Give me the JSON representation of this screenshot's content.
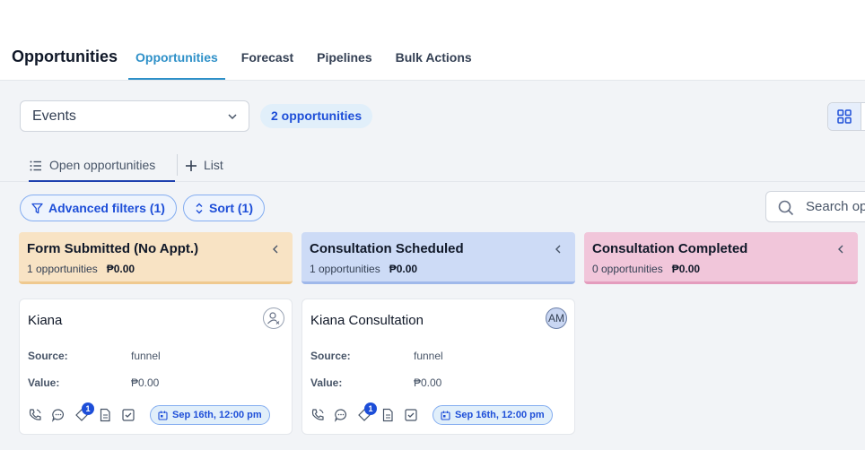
{
  "header": {
    "title": "Opportunities",
    "tabs": [
      {
        "label": "Opportunities",
        "active": true
      },
      {
        "label": "Forecast",
        "active": false
      },
      {
        "label": "Pipelines",
        "active": false
      },
      {
        "label": "Bulk Actions",
        "active": false
      }
    ]
  },
  "toolbar": {
    "pipeline_value": "Events",
    "count_badge": "2 opportunities"
  },
  "subtabs": {
    "open": "Open opportunities",
    "list": "List"
  },
  "filters": {
    "advanced": "Advanced filters (1)",
    "sort": "Sort (1)",
    "search_placeholder": "Search opportunities"
  },
  "columns": [
    {
      "title": "Form Submitted (No Appt.)",
      "count": "1 opportunities",
      "value": "₱0.00",
      "color": "#f8e3c4"
    },
    {
      "title": "Consultation Scheduled",
      "count": "1 opportunities",
      "value": "₱0.00",
      "color": "#cddbf6"
    },
    {
      "title": "Consultation Completed",
      "count": "0 opportunities",
      "value": "₱0.00",
      "color": "#f1c6da"
    }
  ],
  "cards": [
    {
      "name": "Kiana",
      "source_label": "Source:",
      "source": "funnel",
      "value_label": "Value:",
      "value": "₱0.00",
      "date": "Sep 16th, 12:00 pm",
      "badge": "1",
      "avatar": ""
    },
    {
      "name": "Kiana Consultation",
      "source_label": "Source:",
      "source": "funnel",
      "value_label": "Value:",
      "value": "₱0.00",
      "date": "Sep 16th, 12:00 pm",
      "badge": "1",
      "avatar": "AM"
    }
  ],
  "colors": {
    "accent": "#1d4ed8",
    "tab_active": "#2e90c8"
  }
}
